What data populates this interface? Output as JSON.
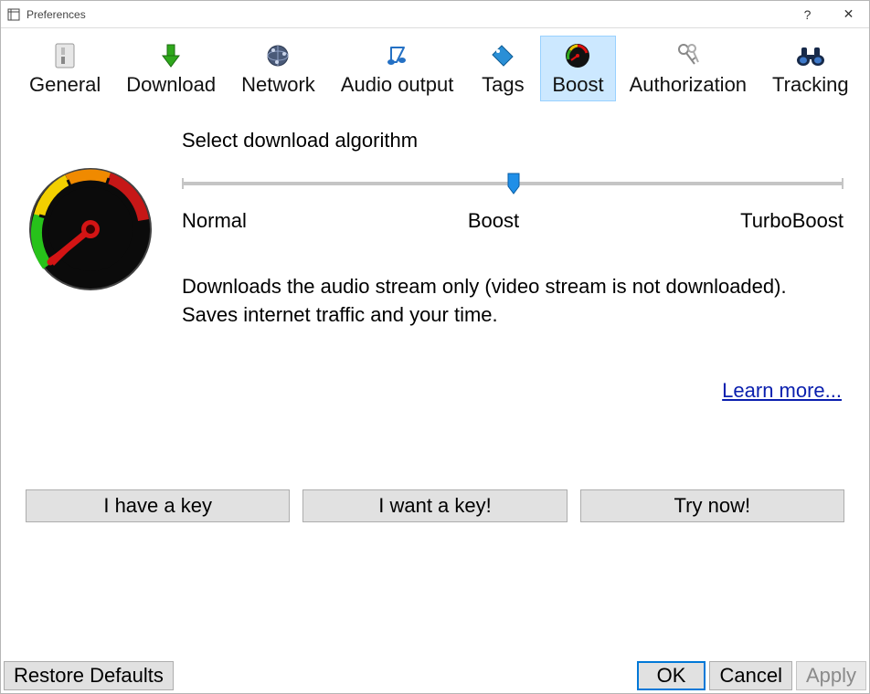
{
  "window": {
    "title": "Preferences",
    "help_symbol": "?",
    "close_symbol": "✕"
  },
  "tabs": {
    "general": "General",
    "download": "Download",
    "network": "Network",
    "audio": "Audio output",
    "tags": "Tags",
    "boost": "Boost",
    "authorization": "Authorization",
    "tracking": "Tracking",
    "selected": "boost"
  },
  "boost": {
    "heading": "Select download algorithm",
    "slider": {
      "levels": [
        "Normal",
        "Boost",
        "TurboBoost"
      ],
      "value_index": 1
    },
    "description": "Downloads the audio stream only (video stream is not downloaded). Saves internet traffic and your time.",
    "learn_more": "Learn more..."
  },
  "key_buttons": {
    "have": "I have a key",
    "want": "I want a key!",
    "try": "Try now!"
  },
  "bottom": {
    "restore": "Restore Defaults",
    "ok": "OK",
    "cancel": "Cancel",
    "apply": "Apply"
  }
}
